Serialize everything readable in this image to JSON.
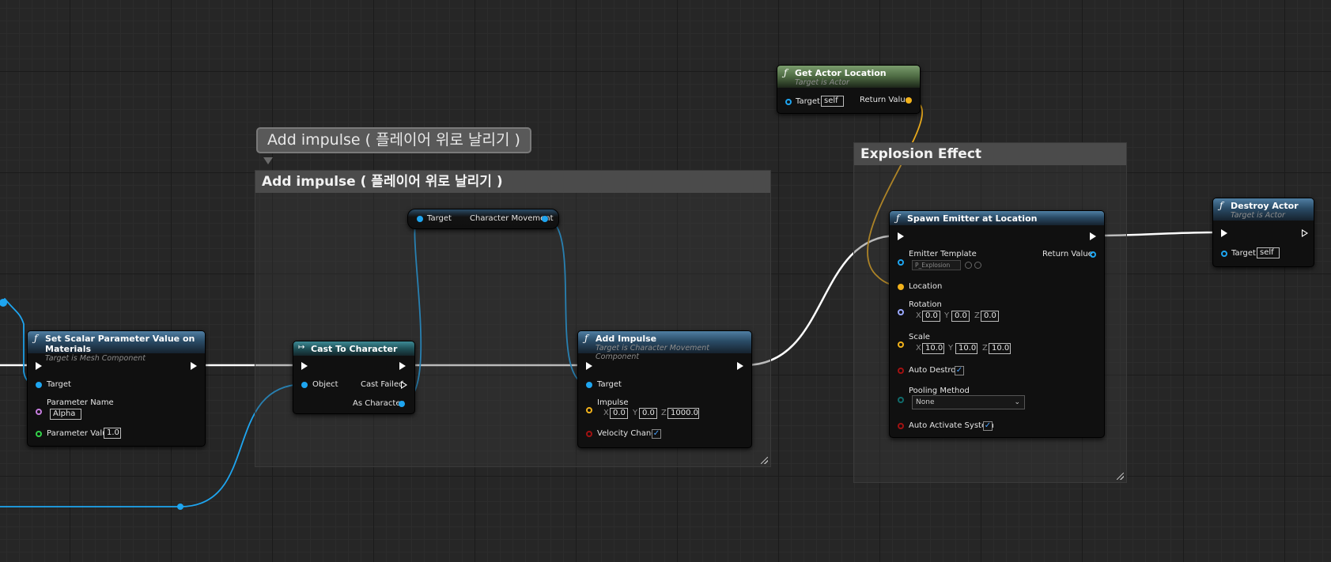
{
  "comments": {
    "add_impulse": {
      "title": "Add impulse ( 플레이어 위로 날리기 )",
      "bubble": "Add impulse ( 플레이어 위로 날리기 )"
    },
    "explosion": {
      "title": "Explosion Effect"
    }
  },
  "nodes": {
    "set_scalar": {
      "title": "Set Scalar Parameter Value on Materials",
      "subtitle": "Target is Mesh Component",
      "target": "Target",
      "param_name_label": "Parameter Name",
      "param_name_value": "Alpha",
      "param_value_label": "Parameter Value",
      "param_value_value": "1.0"
    },
    "cast": {
      "title": "Cast To Character",
      "object": "Object",
      "cast_failed": "Cast Failed",
      "as_character": "As Character"
    },
    "char_movement": {
      "target": "Target",
      "output": "Character Movement"
    },
    "add_impulse": {
      "title": "Add Impulse",
      "subtitle": "Target is Character Movement Component",
      "target": "Target",
      "impulse": "Impulse",
      "x": "0.0",
      "y": "0.0",
      "z": "1000.0",
      "velocity_change": "Velocity Change",
      "velocity_checked": "✓"
    },
    "get_actor_location": {
      "title": "Get Actor Location",
      "subtitle": "Target is Actor",
      "target": "Target",
      "target_value": "self",
      "return_value": "Return Value"
    },
    "spawn_emitter": {
      "title": "Spawn Emitter at Location",
      "emitter_template": "Emitter Template",
      "template_value": "P_Explosion",
      "return_value": "Return Value",
      "location": "Location",
      "rotation": "Rotation",
      "rot_x": "0.0",
      "rot_y": "0.0",
      "rot_z": "0.0",
      "scale": "Scale",
      "scale_x": "10.0",
      "scale_y": "10.0",
      "scale_z": "10.0",
      "auto_destroy": "Auto Destroy",
      "auto_destroy_checked": "✓",
      "pooling_method": "Pooling Method",
      "pooling_value": "None",
      "auto_activate": "Auto Activate System",
      "auto_activate_checked": "✓"
    },
    "destroy_actor": {
      "title": "Destroy Actor",
      "subtitle": "Target is Actor",
      "target": "Target",
      "target_value": "self"
    }
  },
  "axis": {
    "x": "X",
    "y": "Y",
    "z": "Z"
  },
  "icons": {
    "function": "f-function-icon",
    "cast": "cast-arrow-icon"
  },
  "colors": {
    "exec": "#ffffff",
    "object_pin": "#1ea5f0",
    "vector_pin": "#f2b21b",
    "rotator_pin": "#9aa8ff",
    "name_pin": "#c77ee0",
    "float_pin": "#34d24a",
    "bool_pin": "#a21212",
    "byte_pin": "#106b6b"
  }
}
